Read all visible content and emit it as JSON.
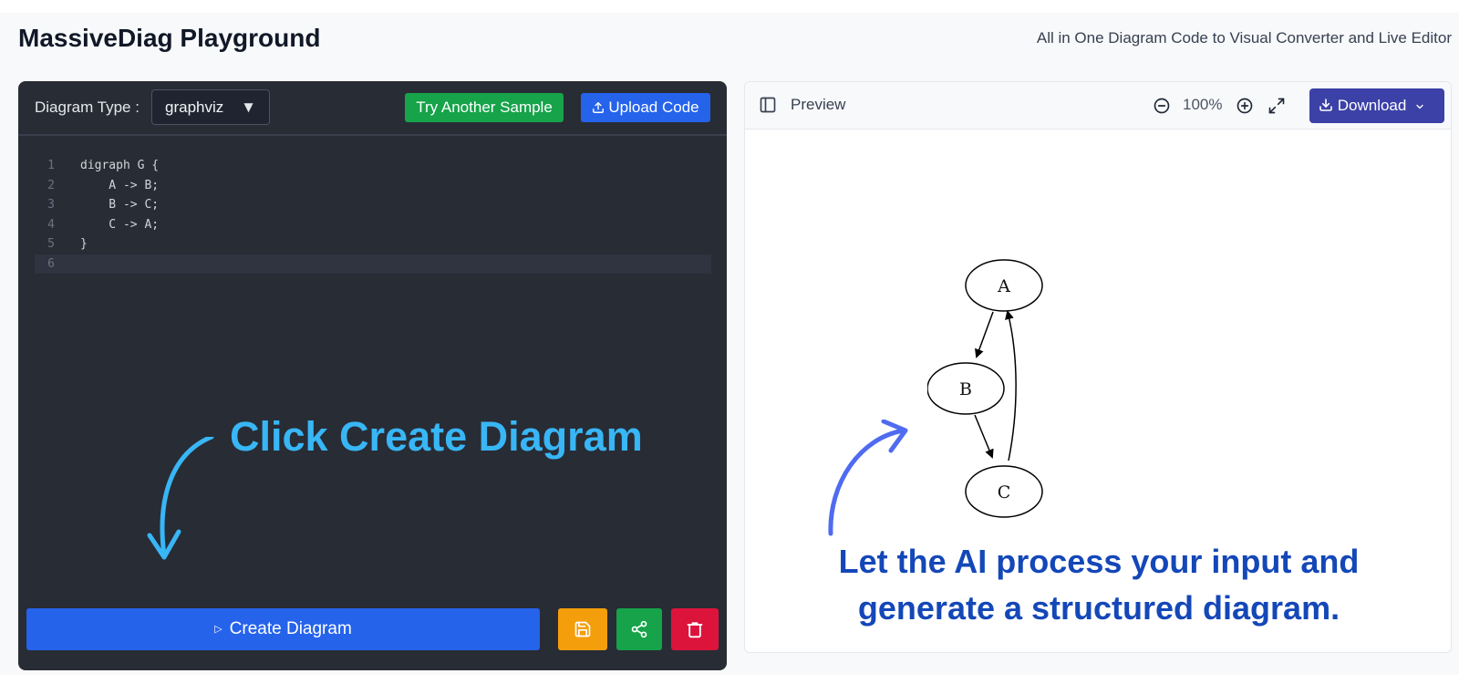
{
  "header": {
    "title": "MassiveDiag Playground",
    "subtitle": "All in One Diagram Code to Visual Converter and Live Editor"
  },
  "editor": {
    "type_label": "Diagram Type :",
    "type_value": "graphviz",
    "sample_button": "Try Another Sample",
    "upload_button": "Upload Code",
    "code_lines": [
      {
        "num": "1",
        "text": "digraph G {"
      },
      {
        "num": "2",
        "text": "    A -> B;"
      },
      {
        "num": "3",
        "text": "    B -> C;"
      },
      {
        "num": "4",
        "text": "    C -> A;"
      },
      {
        "num": "5",
        "text": "}"
      },
      {
        "num": "6",
        "text": ""
      }
    ],
    "hint": "Click Create Diagram",
    "create_button": "Create Diagram"
  },
  "preview": {
    "label": "Preview",
    "zoom": "100%",
    "download_button": "Download",
    "nodes": [
      {
        "id": "A",
        "label": "A"
      },
      {
        "id": "B",
        "label": "B"
      },
      {
        "id": "C",
        "label": "C"
      }
    ],
    "hint_line1": "Let the AI process your input and",
    "hint_line2": "generate a structured diagram."
  },
  "colors": {
    "accent_blue": "#2563eb",
    "green": "#16a34a",
    "amber": "#f59e0b",
    "crimson": "#dc143c",
    "download": "#3b41a6",
    "hint_left": "#38b6f5",
    "hint_right": "#1447b8"
  },
  "icons": [
    "upload-icon",
    "play-icon",
    "save-icon",
    "share-icon",
    "trash-icon",
    "sidebar-icon",
    "zoom-out-icon",
    "zoom-in-icon",
    "fullscreen-icon",
    "download-icon",
    "chevron-down-icon"
  ]
}
